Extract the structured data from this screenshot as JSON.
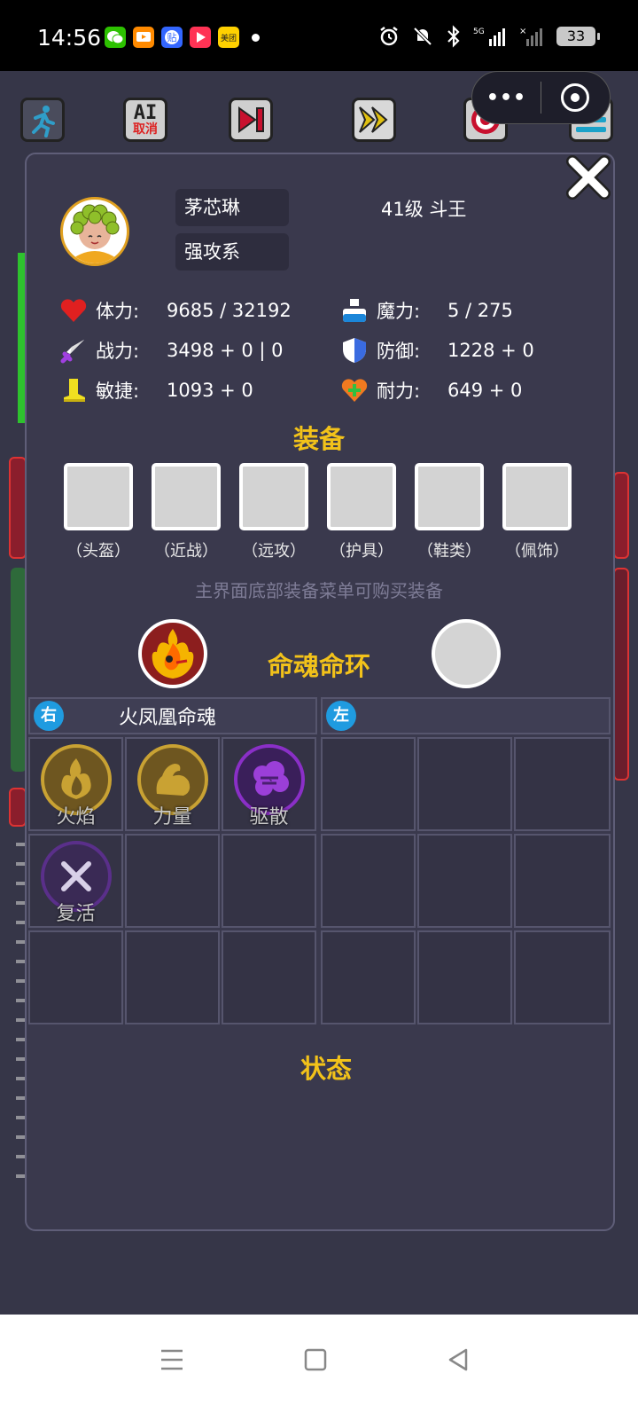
{
  "status_bar": {
    "time": "14:56",
    "apps": [
      {
        "name": "wechat-icon",
        "color": "#2dc100",
        "glyph": "💬"
      },
      {
        "name": "tv-app-icon",
        "color": "#ff8a00",
        "glyph": "▶"
      },
      {
        "name": "tieba-icon",
        "color": "#3366ff",
        "glyph": "贴"
      },
      {
        "name": "video-app-icon",
        "color": "#ff3355",
        "glyph": "▶"
      },
      {
        "name": "meituan-icon",
        "color": "#ffd100",
        "glyph": "美团"
      }
    ],
    "battery": "33"
  },
  "toolbar": {
    "ai_label": "AI",
    "ai_sub": "取消",
    "capsule_more": "•••"
  },
  "character": {
    "name": "茅芯琳",
    "type": "强攻系",
    "level": "41级 斗王"
  },
  "stats": {
    "hp_label": "体力:",
    "hp_value": "9685 / 32192",
    "mp_label": "魔力:",
    "mp_value": "5 / 275",
    "atk_label": "战力:",
    "atk_value": "3498 + 0 | 0",
    "def_label": "防御:",
    "def_value": "1228 + 0",
    "agi_label": "敏捷:",
    "agi_value": "1093 + 0",
    "sta_label": "耐力:",
    "sta_value": "649 + 0"
  },
  "equipment": {
    "title": "装备",
    "slots": [
      "（头盔）",
      "（近战）",
      "（远攻）",
      "（护具）",
      "（鞋类）",
      "（佩饰）"
    ],
    "hint": "主界面底部装备菜单可购买装备"
  },
  "soul": {
    "title": "命魂命环",
    "right_badge": "右",
    "right_name": "火凤凰命魂",
    "left_badge": "左",
    "left_name": ""
  },
  "skills": [
    {
      "label": "火焰",
      "color": "#c9a233"
    },
    {
      "label": "力量",
      "color": "#c9a233"
    },
    {
      "label": "驱散",
      "color": "#8a2fc7"
    },
    {
      "label": "复活",
      "color": "#6a2f9a"
    }
  ],
  "status_section": {
    "title": "状态"
  },
  "colors": {
    "accent_gold": "#f2c21a",
    "panel_bg": "#3a394d",
    "badge_blue": "#1f9be0"
  }
}
